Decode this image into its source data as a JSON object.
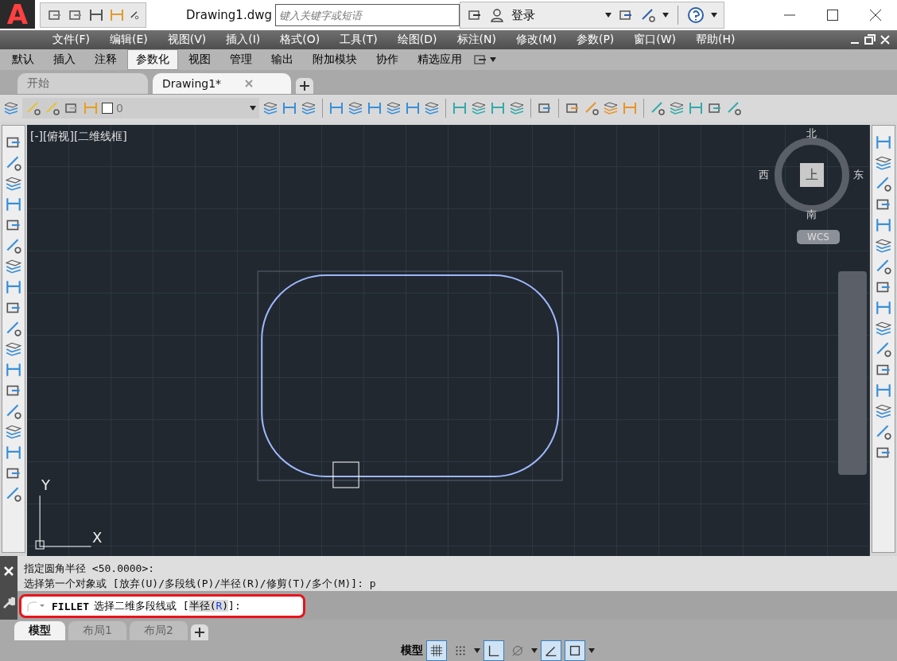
{
  "app": {
    "logo": "A",
    "title": "Drawing1.dwg",
    "search": {
      "placeholder": "键入关键字或短语"
    },
    "user": "登录"
  },
  "menu": [
    "文件(F)",
    "编辑(E)",
    "视图(V)",
    "插入(I)",
    "格式(O)",
    "工具(T)",
    "绘图(D)",
    "标注(N)",
    "修改(M)",
    "参数(P)",
    "窗口(W)",
    "帮助(H)"
  ],
  "ribbon_tabs": [
    {
      "label": "默认",
      "selected": false
    },
    {
      "label": "插入",
      "selected": false
    },
    {
      "label": "注释",
      "selected": false
    },
    {
      "label": "参数化",
      "selected": true
    },
    {
      "label": "视图",
      "selected": false
    },
    {
      "label": "管理",
      "selected": false
    },
    {
      "label": "输出",
      "selected": false
    },
    {
      "label": "附加模块",
      "selected": false
    },
    {
      "label": "协作",
      "selected": false
    },
    {
      "label": "精选应用",
      "selected": false
    }
  ],
  "file_tabs": [
    {
      "label": "开始",
      "selected": false
    },
    {
      "label": "Drawing1*",
      "selected": true
    }
  ],
  "layer": {
    "name": "0"
  },
  "viewport": {
    "label": "[-][俯视][二维线框]",
    "viewcube": {
      "north": "北",
      "west": "西",
      "east": "东",
      "south": "南",
      "face": "上",
      "ucs": "WCS"
    },
    "axes": {
      "x": "X",
      "y": "Y"
    }
  },
  "command": {
    "history": [
      "指定圆角半径 <50.0000>:",
      "选择第一个对象或 [放弃(U)/多段线(P)/半径(R)/修剪(T)/多个(M)]: p"
    ],
    "prompt": {
      "command": "FILLET",
      "text": "选择二维多段线或 [",
      "option_pre": "半径(",
      "key": "R",
      "option_post": ")",
      "end": "]:"
    },
    "highlighted": true
  },
  "layout_tabs": [
    {
      "label": "模型",
      "selected": true
    },
    {
      "label": "布局1",
      "selected": false
    },
    {
      "label": "布局2",
      "selected": false
    }
  ],
  "status": {
    "label": "模型",
    "toggles": [
      {
        "kind": "grid",
        "on": true
      },
      {
        "kind": "snap",
        "on": false
      },
      {
        "kind": "ortho",
        "on": true
      },
      {
        "kind": "polar",
        "on": false
      },
      {
        "kind": "isodraft",
        "on": true
      },
      {
        "kind": "osnap",
        "on": true
      }
    ]
  }
}
